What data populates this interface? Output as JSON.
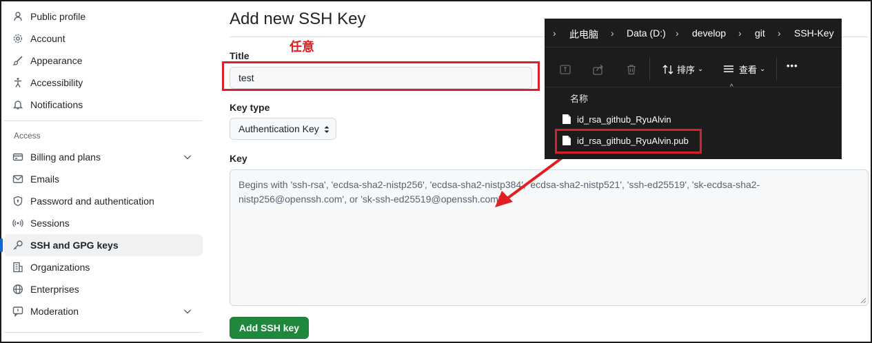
{
  "sidebar": {
    "items_top": [
      {
        "label": "Public profile",
        "icon": "person-icon"
      },
      {
        "label": "Account",
        "icon": "gear-icon"
      },
      {
        "label": "Appearance",
        "icon": "paintbrush-icon"
      },
      {
        "label": "Accessibility",
        "icon": "accessibility-icon"
      },
      {
        "label": "Notifications",
        "icon": "bell-icon"
      }
    ],
    "section_label": "Access",
    "items_access": [
      {
        "label": "Billing and plans",
        "icon": "credit-card-icon"
      },
      {
        "label": "Emails",
        "icon": "mail-icon"
      },
      {
        "label": "Password and authentication",
        "icon": "shield-lock-icon"
      },
      {
        "label": "Sessions",
        "icon": "broadcast-icon"
      },
      {
        "label": "SSH and GPG keys",
        "icon": "key-icon"
      },
      {
        "label": "Organizations",
        "icon": "organization-icon"
      },
      {
        "label": "Enterprises",
        "icon": "globe-icon"
      },
      {
        "label": "Moderation",
        "icon": "report-icon"
      }
    ]
  },
  "main": {
    "page_title": "Add new SSH Key",
    "title_label": "Title",
    "title_value": "test",
    "annotation": "任意",
    "key_type_label": "Key type",
    "key_type_value": "Authentication Key",
    "key_label": "Key",
    "key_placeholder": "Begins with 'ssh-rsa', 'ecdsa-sha2-nistp256', 'ecdsa-sha2-nistp384', 'ecdsa-sha2-nistp521', 'ssh-ed25519', 'sk-ecdsa-sha2-nistp256@openssh.com', or 'sk-ssh-ed25519@openssh.com'",
    "submit_label": "Add SSH key"
  },
  "explorer": {
    "breadcrumb": [
      "此电脑",
      "Data (D:)",
      "develop",
      "git",
      "SSH-Key"
    ],
    "toolbar": {
      "sort_label": "排序",
      "view_label": "查看",
      "more_label": "•••"
    },
    "column_header": "名称",
    "files": [
      "id_rsa_github_RyuAlvin",
      "id_rsa_github_RyuAlvin.pub"
    ]
  },
  "colors": {
    "accent": "#0969da",
    "submit_green": "#1f883d",
    "annotation_red": "#d9212b",
    "explorer_bg": "#1c1c1c"
  }
}
